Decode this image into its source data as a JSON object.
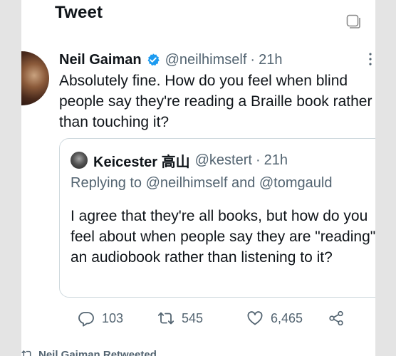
{
  "header": {
    "title": "Tweet"
  },
  "tweet": {
    "author_name": "Neil Gaiman",
    "handle": "@neilhimself",
    "separator": "·",
    "time": "21h",
    "text": "Absolutely fine. How do you feel when blind people say they're reading a Braille book rather than touching it?"
  },
  "quote": {
    "author_name": "Keicester 高山",
    "handle": "@kestert",
    "separator": "·",
    "time": "21h",
    "replying_to": "Replying to @neilhimself and @tomgauld",
    "text": "I agree that they're all books, but how do you feel about when people say they are \"reading\" an audiobook rather than listening to it?"
  },
  "actions": {
    "replies": "103",
    "retweets": "545",
    "likes": "6,465"
  },
  "footer": {
    "retweeted_label": "Neil Gaiman Retweeted"
  },
  "icons": {
    "verified": "verified-badge-icon",
    "reply": "speech-bubble-icon",
    "retweet": "retweet-arrows-icon",
    "like": "heart-icon",
    "share": "share-nodes-icon",
    "more": "vertical-ellipsis-icon",
    "header": "window-icon"
  },
  "colors": {
    "verified_blue": "#1d9bf0",
    "secondary_text": "#536471",
    "border": "#cfd9de"
  }
}
